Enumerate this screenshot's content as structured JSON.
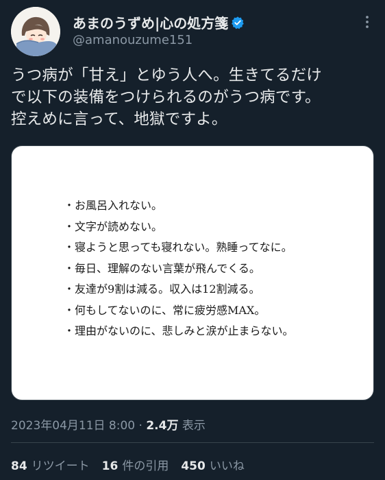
{
  "author": {
    "display_name": "あまのうずめ|心の処方箋",
    "handle": "@amanouzume151",
    "avatar_icon": "avatar-illustration",
    "verified_icon": "verified-badge-icon",
    "verified_color": "#1d9bf0"
  },
  "more_icon": "more-options-icon",
  "tweet": {
    "lines": [
      "うつ病が「甘え」とゆう人へ。生きてるだけ",
      "で以下の装備をつけられるのがうつ病です。",
      "控えめに言って、地獄ですよ。"
    ]
  },
  "media": {
    "lines": [
      "・お風呂入れない。",
      "・文字が読めない。",
      "・寝ようと思っても寝れない。熟睡ってなに。",
      "・毎日、理解のない言葉が飛んでくる。",
      "・友達が9割は減る。収入は12割減る。",
      "・何もしてないのに、常に疲労感MAX。",
      "・理由がないのに、悲しみと涙が止まらない。"
    ]
  },
  "meta": {
    "timestamp": "2023年04月11日 8:00",
    "separator": "·",
    "views_count": "2.4万",
    "views_label": "表示"
  },
  "stats": {
    "retweets": {
      "count": "84",
      "label": "リツイート"
    },
    "quotes": {
      "count": "16",
      "label": "件の引用"
    },
    "likes": {
      "count": "450",
      "label": "いいね"
    }
  },
  "colors": {
    "background": "#15202b",
    "text_primary": "#e7e9ea",
    "text_secondary": "#8b98a5",
    "border": "#38444d"
  }
}
